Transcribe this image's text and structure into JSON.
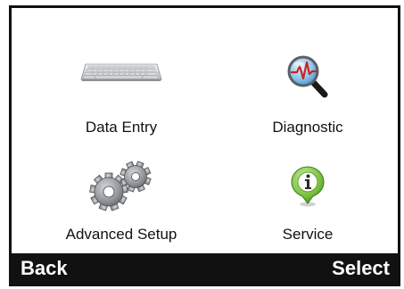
{
  "menu": {
    "items": [
      {
        "label": "Data Entry",
        "icon": "keyboard-icon"
      },
      {
        "label": "Diagnostic",
        "icon": "magnifier-heartbeat-icon"
      },
      {
        "label": "Advanced Setup",
        "icon": "gears-icon"
      },
      {
        "label": "Service",
        "icon": "info-bubble-icon"
      }
    ]
  },
  "softkeys": {
    "left_label": "Back",
    "right_label": "Select"
  },
  "colors": {
    "bar_background": "#111111",
    "bar_text": "#ffffff",
    "diagnostic_lens": "#5aa8d8",
    "diagnostic_pulse": "#cc2222",
    "service_green": "#7cc242",
    "gear_gray": "#8a8e93"
  }
}
